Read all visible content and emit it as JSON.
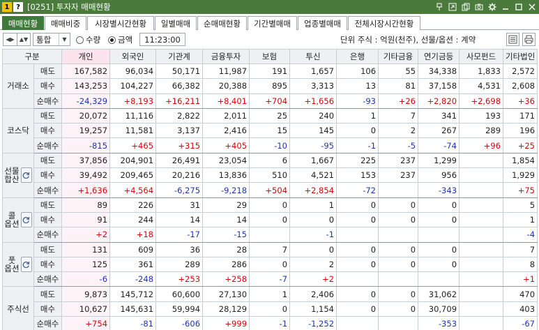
{
  "window": {
    "badge1": "1",
    "badge2": "?",
    "title": "[0251] 투자자 매매현황"
  },
  "tabs": [
    {
      "label": "매매현황",
      "active": true
    },
    {
      "label": "매매비중"
    },
    {
      "label": "시장별시간현황"
    },
    {
      "label": "일별매매"
    },
    {
      "label": "순매매현황"
    },
    {
      "label": "기간별매매"
    },
    {
      "label": "업종별매매"
    },
    {
      "label": "전체시장시간현황"
    }
  ],
  "toolbar": {
    "market_select": "통합",
    "radio_quantity": "수량",
    "radio_amount": "금액",
    "selected_radio": "금액",
    "time": "11:23:00",
    "unit_text": "단위 주식 : 억원(천주), 선물/옵션 : 계약"
  },
  "table": {
    "headers": [
      "구분",
      "",
      "개인",
      "외국인",
      "기관계",
      "금융투자",
      "보험",
      "투신",
      "은행",
      "기타금융",
      "연기금등",
      "사모펀드",
      "기타법인"
    ],
    "groups": [
      {
        "name": "거래소",
        "button": false,
        "rows": [
          {
            "label": "매도",
            "values": [
              "167,582",
              "96,034",
              "50,171",
              "11,987",
              "191",
              "1,657",
              "106",
              "55",
              "34,338",
              "1,833",
              "2,572"
            ]
          },
          {
            "label": "매수",
            "values": [
              "143,253",
              "104,227",
              "66,382",
              "20,388",
              "895",
              "3,313",
              "13",
              "81",
              "37,158",
              "4,531",
              "2,608"
            ]
          },
          {
            "label": "순매수",
            "values": [
              "-24,329",
              "+8,193",
              "+16,211",
              "+8,401",
              "+704",
              "+1,656",
              "-93",
              "+26",
              "+2,820",
              "+2,698",
              "+36"
            ]
          }
        ]
      },
      {
        "name": "코스닥",
        "button": false,
        "rows": [
          {
            "label": "매도",
            "values": [
              "20,072",
              "11,116",
              "2,822",
              "2,011",
              "25",
              "240",
              "1",
              "7",
              "341",
              "193",
              "171"
            ]
          },
          {
            "label": "매수",
            "values": [
              "19,257",
              "11,581",
              "3,137",
              "2,416",
              "15",
              "145",
              "0",
              "2",
              "267",
              "289",
              "196"
            ]
          },
          {
            "label": "순매수",
            "values": [
              "-815",
              "+465",
              "+315",
              "+405",
              "-10",
              "-95",
              "-1",
              "-5",
              "-74",
              "+96",
              "+25"
            ]
          }
        ]
      },
      {
        "name": "선물\n합산",
        "button": true,
        "rows": [
          {
            "label": "매도",
            "values": [
              "37,856",
              "204,901",
              "26,491",
              "23,054",
              "6",
              "1,667",
              "225",
              "237",
              "1,299",
              "",
              "1,854"
            ]
          },
          {
            "label": "매수",
            "values": [
              "39,492",
              "209,465",
              "20,216",
              "13,836",
              "510",
              "4,521",
              "153",
              "237",
              "956",
              "",
              "1,929"
            ]
          },
          {
            "label": "순매수",
            "values": [
              "+1,636",
              "+4,564",
              "-6,275",
              "-9,218",
              "+504",
              "+2,854",
              "-72",
              "",
              "-343",
              "",
              "+75"
            ]
          }
        ]
      },
      {
        "name": "콜\n옵션",
        "button": true,
        "rows": [
          {
            "label": "매도",
            "values": [
              "89",
              "226",
              "31",
              "29",
              "0",
              "1",
              "0",
              "0",
              "0",
              "",
              "5"
            ]
          },
          {
            "label": "매수",
            "values": [
              "91",
              "244",
              "14",
              "14",
              "0",
              "0",
              "0",
              "0",
              "0",
              "",
              "1"
            ]
          },
          {
            "label": "순매수",
            "values": [
              "+2",
              "+18",
              "-17",
              "-15",
              "",
              "-1",
              "",
              "",
              "",
              "",
              "-4"
            ]
          }
        ]
      },
      {
        "name": "풋\n옵션",
        "button": true,
        "rows": [
          {
            "label": "매도",
            "values": [
              "131",
              "609",
              "36",
              "28",
              "7",
              "0",
              "0",
              "0",
              "0",
              "",
              "7"
            ]
          },
          {
            "label": "매수",
            "values": [
              "125",
              "361",
              "289",
              "286",
              "0",
              "2",
              "0",
              "0",
              "0",
              "",
              "8"
            ]
          },
          {
            "label": "순매수",
            "values": [
              "-6",
              "-248",
              "+253",
              "+258",
              "-7",
              "+2",
              "",
              "",
              "",
              "",
              "+1"
            ]
          }
        ]
      },
      {
        "name": "주식선",
        "button": false,
        "rows": [
          {
            "label": "매도",
            "values": [
              "9,873",
              "145,712",
              "60,600",
              "27,130",
              "1",
              "2,406",
              "0",
              "0",
              "31,062",
              "",
              "470"
            ]
          },
          {
            "label": "매수",
            "values": [
              "10,627",
              "145,631",
              "59,994",
              "28,129",
              "0",
              "1,154",
              "0",
              "0",
              "30,709",
              "",
              "403"
            ]
          },
          {
            "label": "순매수",
            "values": [
              "+754",
              "-81",
              "-606",
              "+999",
              "-1",
              "-1,252",
              "",
              "",
              "-353",
              "",
              "-67"
            ]
          }
        ]
      }
    ]
  },
  "colors": {
    "title_bar": "#4a7a3c",
    "active_tab": "#3d7a3a",
    "positive": "#e0000b",
    "negative": "#1d34b8",
    "header_bg": "#eef0f3",
    "individual_header_bg": "#fbe4ec"
  },
  "icons": {
    "title_bar": [
      "pin-icon",
      "link-icon",
      "copy-icon",
      "camera-icon",
      "gear-icon",
      "minimize-icon",
      "maximize-icon",
      "close-icon"
    ],
    "toolbar": [
      "prev-arrow-icon",
      "next-arrow-icon",
      "dropdown-icon",
      "list-view-icon",
      "print-icon"
    ],
    "group_button": "refresh-icon"
  }
}
